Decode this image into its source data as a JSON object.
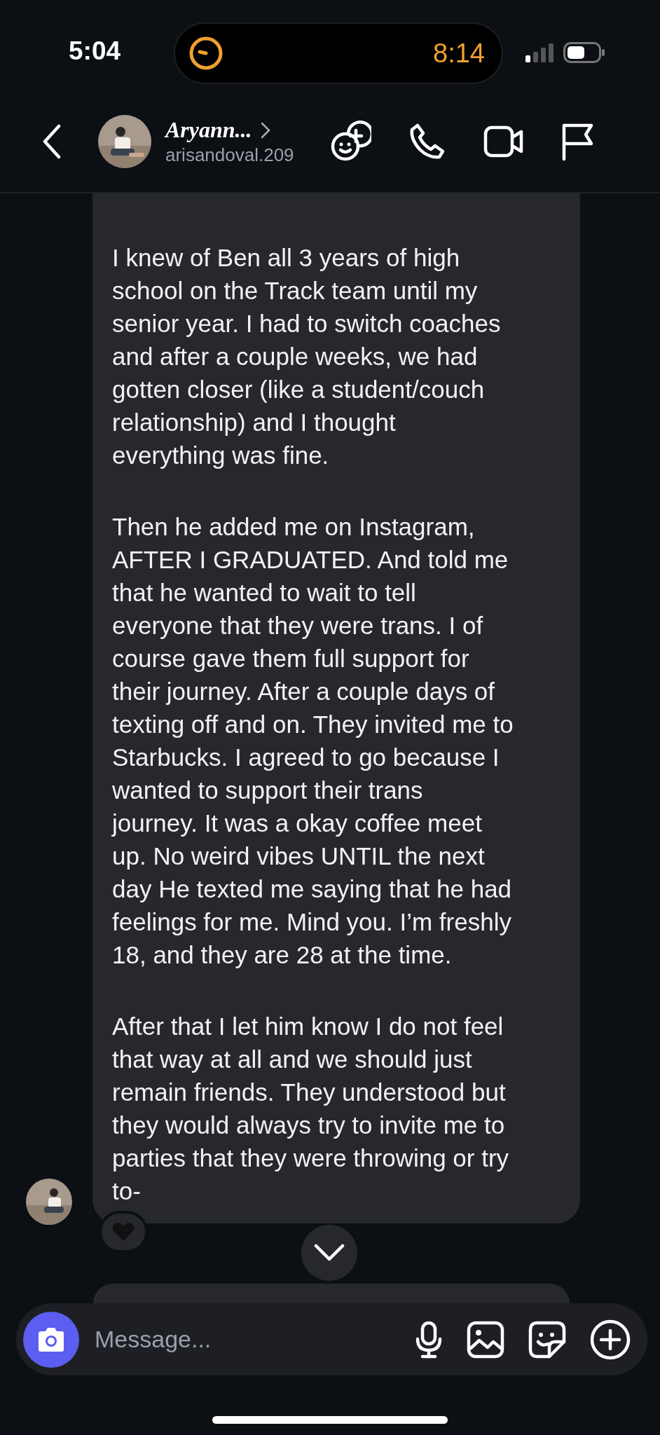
{
  "status_bar": {
    "time": "5:04",
    "timer": "8:14"
  },
  "header": {
    "name": "Aryann...",
    "username": "arisandoval.209"
  },
  "message": {
    "paragraphs": [
      [
        "I knew of Ben all 3 years of high",
        "school on the Track team until my",
        "senior year. I had to switch coaches",
        "and after a couple weeks, we had",
        "gotten closer (like a student/couch",
        "relationship) and I thought",
        "everything was fine."
      ],
      [
        "Then he added me on Instagram,",
        "AFTER I GRADUATED. And told me",
        "that he wanted to wait to tell",
        "everyone that they were trans. I of",
        "course gave them full support for",
        "their journey. After a couple days of",
        "texting off and on. They invited me to",
        "Starbucks. I agreed to go because I",
        "wanted to support their trans",
        "journey. It was a okay coffee meet",
        "up. No weird vibes UNTIL the next",
        "day He texted me saying that he had",
        "feelings for me. Mind you. I’m freshly",
        "18, and they are 28 at the time."
      ],
      [
        "After that I let him know I do not feel",
        "that way at all and we should just",
        "remain friends. They understood but",
        "they would always try to invite me to",
        "parties that they were throwing or try",
        "to-"
      ]
    ]
  },
  "composer": {
    "placeholder": "Message..."
  }
}
